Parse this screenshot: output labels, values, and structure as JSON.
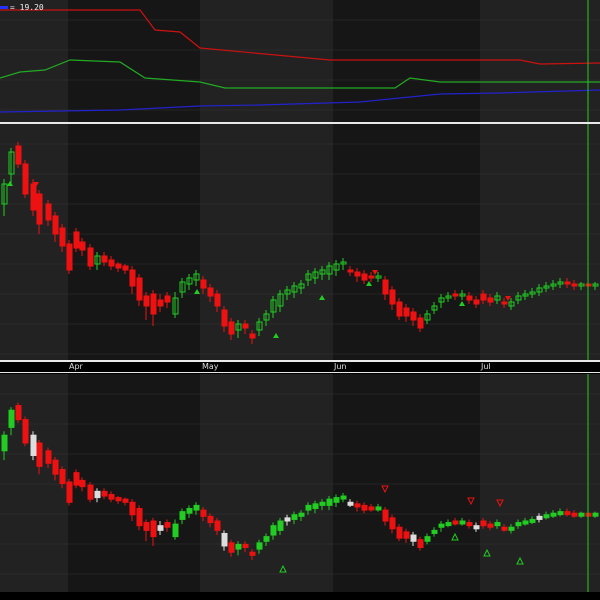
{
  "legend": {
    "value": "19.20",
    "color": "#2233ff"
  },
  "months": [
    "Apr",
    "May",
    "Jun",
    "Jul"
  ],
  "colors": {
    "up": "#22cc22",
    "down": "#ee1111",
    "neutral": "#dddddd",
    "bg_light": "#222222",
    "bg_dark": "#161616",
    "cursor": "#22cc22",
    "ind_red": "#cc1111",
    "ind_green": "#22aa22",
    "ind_blue": "#2222cc"
  },
  "icons": {
    "buy": "green-up-arrow-icon",
    "sell": "red-down-arrow-icon"
  }
}
